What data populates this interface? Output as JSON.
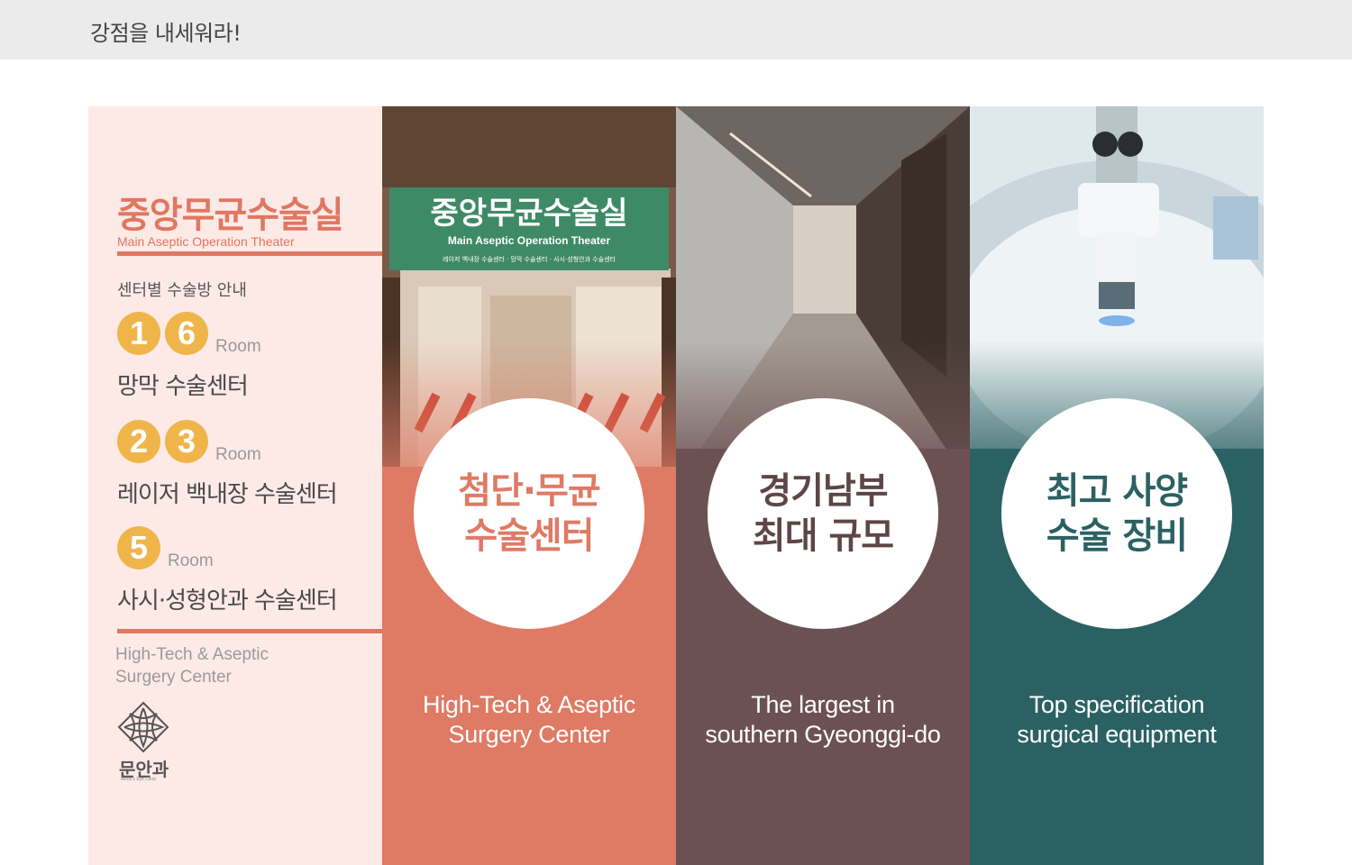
{
  "header": {
    "title": "강점을 내세워라!"
  },
  "info": {
    "title": "중앙무균수술실",
    "subtitle": "Main Aseptic Operation Theater",
    "guide_label": "센터별 수술방 안내",
    "rooms": [
      {
        "numbers": [
          "1",
          "6"
        ],
        "room_label": "Room",
        "center": "망막 수술센터"
      },
      {
        "numbers": [
          "2",
          "3"
        ],
        "room_label": "Room",
        "center": "레이저 백내장 수술센터"
      },
      {
        "numbers": [
          "5"
        ],
        "room_label": "Room",
        "center": "사시·성형안과 수술센터"
      }
    ],
    "footer_line1": "High-Tech & Aseptic",
    "footer_line2": "Surgery Center",
    "logo_text": "문안과",
    "logo_tiny": "Moon's Eye Clinic"
  },
  "panels": [
    {
      "circle_line1": "첨단·무균",
      "circle_line2": "수술센터",
      "caption_line1": "High-Tech & Aseptic",
      "caption_line2": "Surgery Center",
      "sign_title": "중앙무균수술실",
      "sign_sub": "Main Aseptic Operation Theater",
      "sign_small": "레이저 백내장 수술센터 · 망막 수술센터 · 사시·성형안과 수술센터",
      "color": "#df7a65"
    },
    {
      "circle_line1": "경기남부",
      "circle_line2": "최대 규모",
      "caption_line1": "The largest in",
      "caption_line2": "southern Gyeonggi-do",
      "color": "#6c5153"
    },
    {
      "circle_line1": "최고 사양",
      "circle_line2": "수술 장비",
      "caption_line1": "Top specification",
      "caption_line2": "surgical equipment",
      "color": "#2b6163"
    }
  ]
}
